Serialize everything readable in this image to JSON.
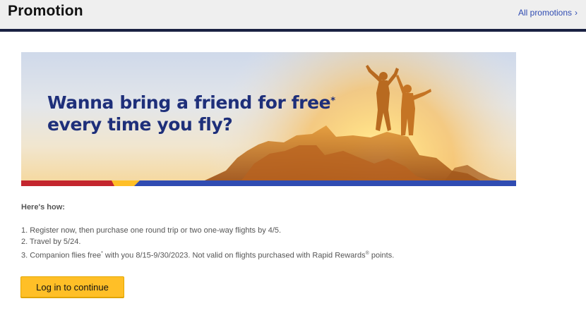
{
  "header": {
    "title": "Promotion",
    "link_label": "All promotions",
    "link_chevron": "›"
  },
  "banner": {
    "headline_line1": "Wanna bring a friend for free",
    "headline_asterisk": "*",
    "headline_line2": "every time you fly?",
    "stripe_colors": [
      "#c4262e",
      "#ffbf27",
      "#304cb2"
    ]
  },
  "instructions": {
    "heading": "Here's how:",
    "step1": "1. Register now, then purchase one round trip or two one-way flights by 4/5.",
    "step2": "2. Travel by 5/24.",
    "step3_a": "3. Companion flies free",
    "step3_mark1": "*",
    "step3_b": " with you 8/15-9/30/2023. Not valid on flights purchased with Rapid Rewards",
    "step3_mark2": "®",
    "step3_c": " points."
  },
  "actions": {
    "login_label": "Log in to continue"
  },
  "colors": {
    "brand_blue": "#304cb2",
    "dark_navy": "#1a2142",
    "cta_yellow": "#ffbf27",
    "brand_red": "#c4262e"
  }
}
